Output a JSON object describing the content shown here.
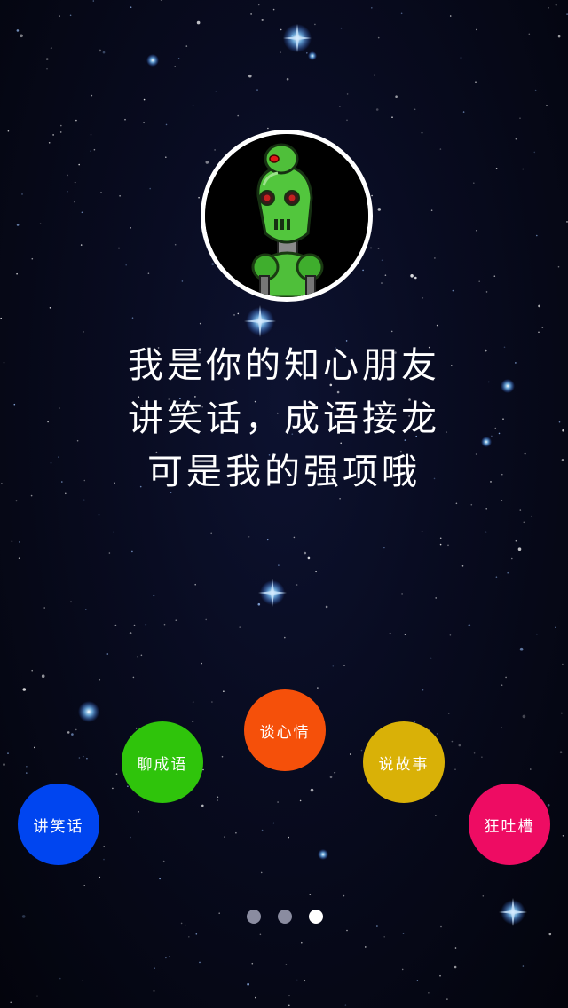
{
  "background": {
    "name": "starry-night-sky",
    "color": "#050714"
  },
  "avatar": {
    "icon": "green-robot-icon",
    "border_color": "#ffffff"
  },
  "intro": {
    "line1": "我是你的知心朋友",
    "line2": "讲笑话，成语接龙",
    "line3": "可是我的强项哦"
  },
  "features": [
    {
      "label": "讲笑话",
      "color": "#0045f0"
    },
    {
      "label": "聊成语",
      "color": "#2fc40b"
    },
    {
      "label": "谈心情",
      "color": "#f5500a"
    },
    {
      "label": "说故事",
      "color": "#d9b107"
    },
    {
      "label": "狂吐槽",
      "color": "#ee0c63"
    }
  ],
  "pager": {
    "pages": 3,
    "current": 3,
    "active_color": "#ffffff",
    "inactive_color": "#8a8ca0"
  }
}
